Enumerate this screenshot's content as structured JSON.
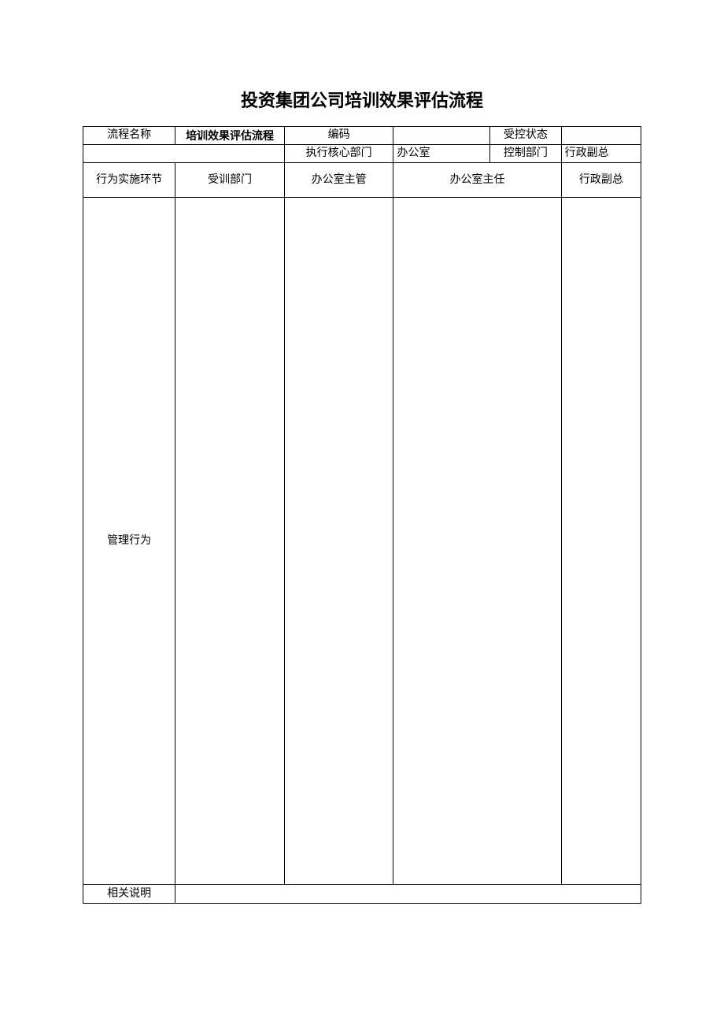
{
  "title": "投资集团公司培训效果评估流程",
  "meta": {
    "process_name_label": "流程名称",
    "process_name_value": "培训效果评估流程",
    "code_label": "编码",
    "code_value": "",
    "control_status_label": "受控状态",
    "control_status_value": "",
    "exec_core_dept_label": "执行核心部门",
    "exec_core_dept_value": "办公室",
    "control_dept_label": "控制部门",
    "control_dept_value": "行政副总"
  },
  "columns": {
    "row_label": "行为实施环节",
    "c1": "受训部门",
    "c2": "办公室主管",
    "c3": "办公室主任",
    "c4": "行政副总"
  },
  "body": {
    "row_label": "管理行为",
    "c1": "",
    "c2": "",
    "c3": "",
    "c4": ""
  },
  "footer": {
    "label": "相关说明",
    "value": ""
  }
}
